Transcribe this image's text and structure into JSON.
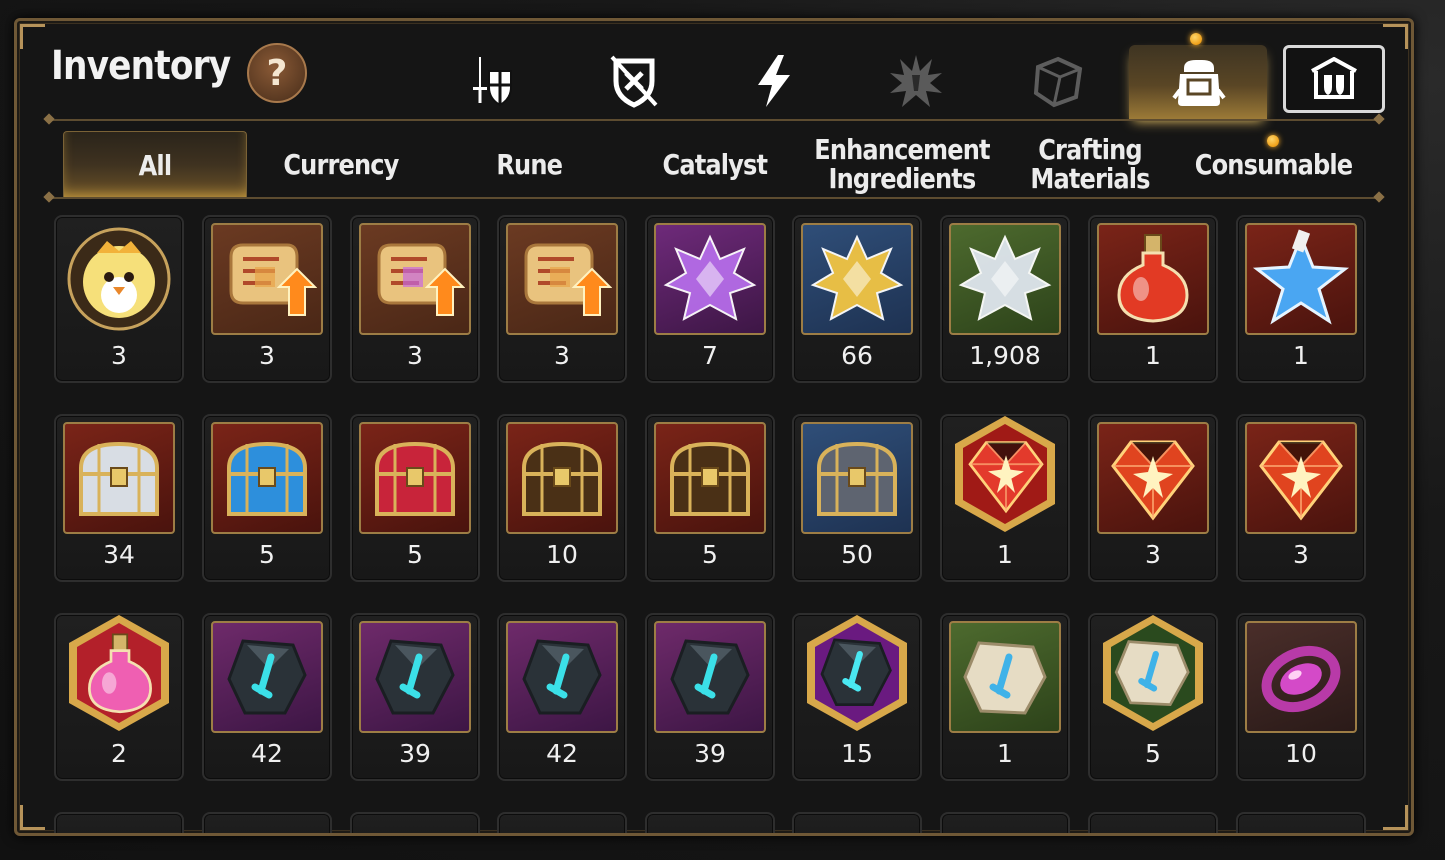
{
  "header": {
    "title": "Inventory",
    "help_label": "?"
  },
  "category_bar": [
    {
      "icon": "sword-shield-icon",
      "active": false
    },
    {
      "icon": "crossed-shield-icon",
      "active": false
    },
    {
      "icon": "lightning-icon",
      "active": false
    },
    {
      "icon": "spiky-burst-icon",
      "active": false
    },
    {
      "icon": "cube-icon",
      "active": false
    },
    {
      "icon": "backpack-icon",
      "active": true,
      "notification": true
    },
    {
      "icon": "shop-shield-icon",
      "active": false
    }
  ],
  "tabs": [
    {
      "label": "All",
      "active": true
    },
    {
      "label": "Currency",
      "active": false
    },
    {
      "label": "Rune",
      "active": false
    },
    {
      "label": "Catalyst",
      "active": false
    },
    {
      "label": "Enhancement Ingredients",
      "active": false
    },
    {
      "label": "Crafting Materials",
      "active": false
    },
    {
      "label": "Consumable",
      "active": false,
      "notification": true
    }
  ],
  "items": [
    {
      "icon": "chick-portrait-icon",
      "count": "3"
    },
    {
      "icon": "scroll-upgrade-icon",
      "count": "3"
    },
    {
      "icon": "rainbow-scroll-upgrade-icon",
      "count": "3"
    },
    {
      "icon": "scroll-upgrade-icon",
      "count": "3"
    },
    {
      "icon": "purple-crystal-icon",
      "count": "7"
    },
    {
      "icon": "gold-crystal-icon",
      "count": "66"
    },
    {
      "icon": "silver-crystal-icon",
      "count": "1,908"
    },
    {
      "icon": "red-potion-icon",
      "count": "1"
    },
    {
      "icon": "star-potion-icon",
      "count": "1"
    },
    {
      "icon": "silver-chest-icon",
      "count": "34"
    },
    {
      "icon": "blue-chest-icon",
      "count": "5"
    },
    {
      "icon": "red-chest-icon",
      "count": "5"
    },
    {
      "icon": "wooden-chest-icon",
      "count": "10"
    },
    {
      "icon": "wooden-chest-icon",
      "count": "5"
    },
    {
      "icon": "steel-chest-icon",
      "count": "50"
    },
    {
      "icon": "red-star-gem-icon",
      "count": "1"
    },
    {
      "icon": "red-gem-icon",
      "count": "3"
    },
    {
      "icon": "red-gem-icon",
      "count": "3"
    },
    {
      "icon": "pink-potion-icon",
      "count": "2"
    },
    {
      "icon": "sword-rune-icon",
      "count": "42"
    },
    {
      "icon": "swirl-rune-icon",
      "count": "39"
    },
    {
      "icon": "armor-rune-icon",
      "count": "42"
    },
    {
      "icon": "boot-rune-icon",
      "count": "39"
    },
    {
      "icon": "star-rune-icon",
      "count": "15"
    },
    {
      "icon": "stone-sword-rune-icon",
      "count": "1"
    },
    {
      "icon": "stone-star-rune-icon",
      "count": "5"
    },
    {
      "icon": "pink-gem-ring-icon",
      "count": "10"
    }
  ]
}
